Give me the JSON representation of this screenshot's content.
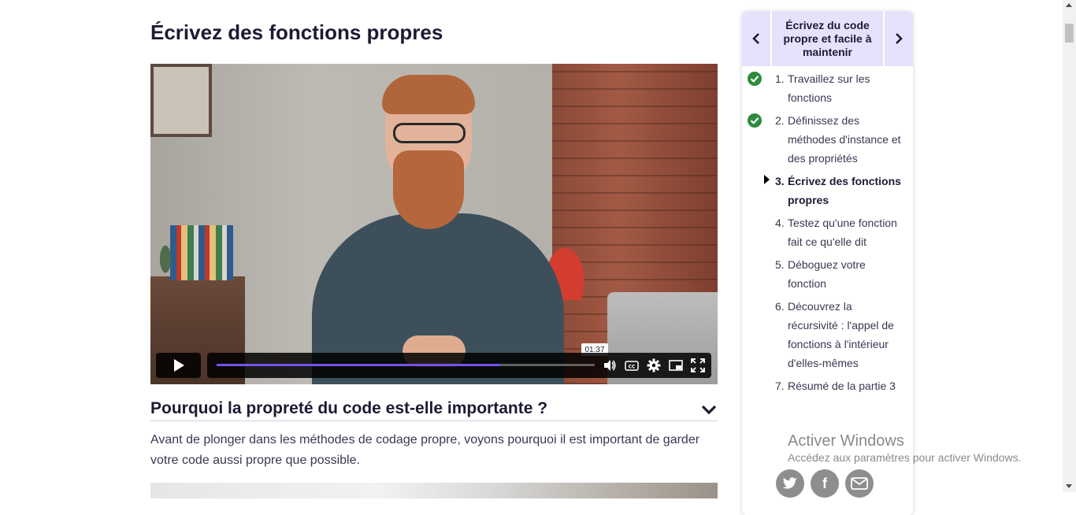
{
  "page": {
    "title": "Écrivez des fonctions propres"
  },
  "video": {
    "timecode": "01:37",
    "progress": 0.75,
    "accent": "#7451eb",
    "icons": [
      "play-icon",
      "volume-icon",
      "captions-icon",
      "settings-icon",
      "picture-in-picture-icon",
      "fullscreen-icon"
    ]
  },
  "section": {
    "heading": "Pourquoi la propreté du code est-elle importante ?",
    "paragraph": "Avant de plonger dans les méthodes de codage propre, voyons pourquoi il est important de garder votre code aussi propre que possible."
  },
  "sidebar": {
    "title": "Écrivez du code propre et facile à maintenir",
    "items": [
      {
        "num": "1.",
        "label": "Travaillez sur les fonctions",
        "status": "done"
      },
      {
        "num": "2.",
        "label": "Définissez des méthodes d'instance et des propriétés",
        "status": "done"
      },
      {
        "num": "3.",
        "label": "Écrivez des fonctions propres",
        "status": "current"
      },
      {
        "num": "4.",
        "label": "Testez qu'une fonction fait ce qu'elle dit",
        "status": "todo"
      },
      {
        "num": "5.",
        "label": "Déboguez votre fonction",
        "status": "todo"
      },
      {
        "num": "6.",
        "label": "Découvrez la récursivité : l'appel de fonctions à l'intérieur d'elles-mêmes",
        "status": "todo"
      },
      {
        "num": "7.",
        "label": "Résumé de la partie 3",
        "status": "todo"
      }
    ],
    "done_color": "#2e8b3d"
  },
  "share": {
    "icons": [
      "twitter-icon",
      "facebook-icon",
      "email-icon"
    ],
    "facebook_glyph": "f"
  },
  "watermark": {
    "line1": "Activer Windows",
    "line2": "Accédez aux paramètres pour activer Windows."
  }
}
